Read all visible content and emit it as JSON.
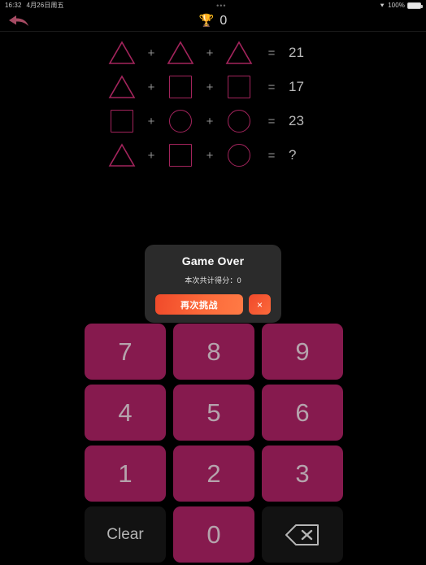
{
  "status_bar": {
    "time": "16:32",
    "date": "4月26日周五",
    "center_dots": "•••",
    "wifi_icon": "wifi-icon",
    "battery_percent": "100%",
    "battery_icon": "battery-full-icon"
  },
  "header": {
    "back_icon": "back-arrow-icon",
    "trophy_icon": "🏆",
    "score": "0"
  },
  "puzzle": {
    "shape_color": "#a3245c",
    "rows": [
      {
        "a": "triangle",
        "op1": "+",
        "b": "triangle",
        "op2": "+",
        "c": "triangle",
        "eq": "=",
        "result": "21"
      },
      {
        "a": "triangle",
        "op1": "+",
        "b": "square",
        "op2": "+",
        "c": "square",
        "eq": "=",
        "result": "17"
      },
      {
        "a": "square",
        "op1": "+",
        "b": "circle",
        "op2": "+",
        "c": "circle",
        "eq": "=",
        "result": "23"
      },
      {
        "a": "triangle",
        "op1": "+",
        "b": "square",
        "op2": "+",
        "c": "circle",
        "eq": "=",
        "result": "?"
      }
    ]
  },
  "keypad": {
    "key_color": "#861a4e",
    "keys": [
      {
        "label": "7",
        "name": "key-7",
        "style": "num"
      },
      {
        "label": "8",
        "name": "key-8",
        "style": "num"
      },
      {
        "label": "9",
        "name": "key-9",
        "style": "num"
      },
      {
        "label": "4",
        "name": "key-4",
        "style": "num"
      },
      {
        "label": "5",
        "name": "key-5",
        "style": "num"
      },
      {
        "label": "6",
        "name": "key-6",
        "style": "num"
      },
      {
        "label": "1",
        "name": "key-1",
        "style": "num"
      },
      {
        "label": "2",
        "name": "key-2",
        "style": "num"
      },
      {
        "label": "3",
        "name": "key-3",
        "style": "num"
      },
      {
        "label": "Clear",
        "name": "key-clear",
        "style": "dark"
      },
      {
        "label": "0",
        "name": "key-0",
        "style": "num"
      },
      {
        "label": "",
        "name": "key-backspace",
        "style": "backspace"
      }
    ]
  },
  "dialog": {
    "title": "Game Over",
    "subtitle": "本次共计得分：0",
    "retry_label": "再次挑战",
    "close_label": "×",
    "accent_color": "#fb6a3b",
    "background": "#2b2b2b"
  }
}
